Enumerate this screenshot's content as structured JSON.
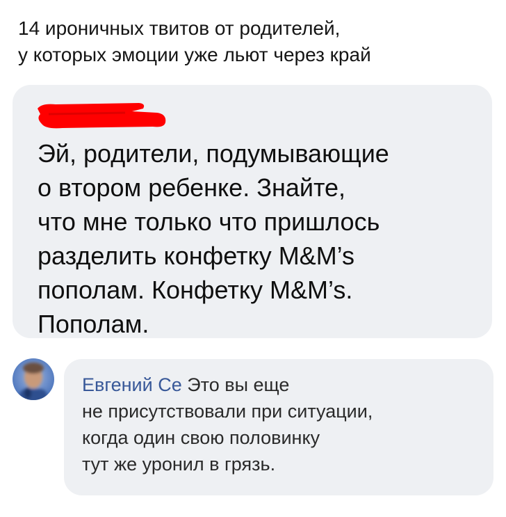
{
  "headline": {
    "line1": "14 ироничных твитов от родителей,",
    "line2": "у которых эмоции уже льют через край"
  },
  "tweet": {
    "lines": [
      "Эй, родители, подумывающие",
      "о втором ребенке. Знайте,",
      "что мне только что пришлось",
      "разделить конфетку M&M’s",
      "пополам. Конфетку M&M’s.",
      "Пополам."
    ]
  },
  "comment": {
    "author": "Евгений Се",
    "line1_rest": "Это вы еще",
    "lines": [
      "не присутствовали при ситуации,",
      "когда один свою половинку",
      "тут же уронил в грязь."
    ]
  },
  "colors": {
    "card_bg": "#eef0f3",
    "author_link": "#385898",
    "redaction": "#ff0000"
  }
}
